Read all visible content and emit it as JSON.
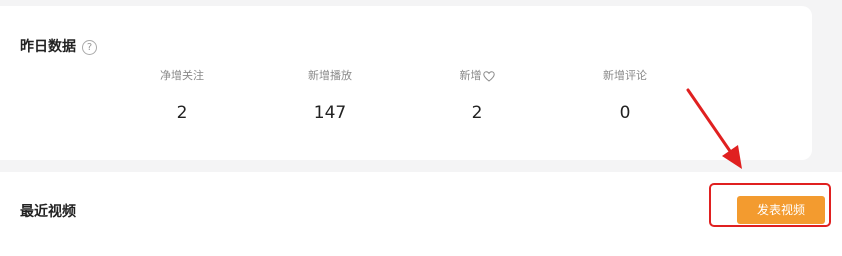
{
  "yesterday": {
    "title": "昨日数据",
    "help_icon": "?",
    "stats": [
      {
        "label": "净增关注",
        "value": "2"
      },
      {
        "label": "新增播放",
        "value": "147"
      },
      {
        "label": "新增",
        "value": "2"
      },
      {
        "label": "新增评论",
        "value": "0"
      }
    ]
  },
  "recent": {
    "title": "最近视频",
    "publish_label": "发表视频"
  },
  "colors": {
    "accent": "#f39b2f",
    "annotation": "#e02020"
  },
  "icons": {
    "help": "question-circle-icon",
    "like": "heart-outline-icon",
    "annotation": "arrow-icon"
  }
}
